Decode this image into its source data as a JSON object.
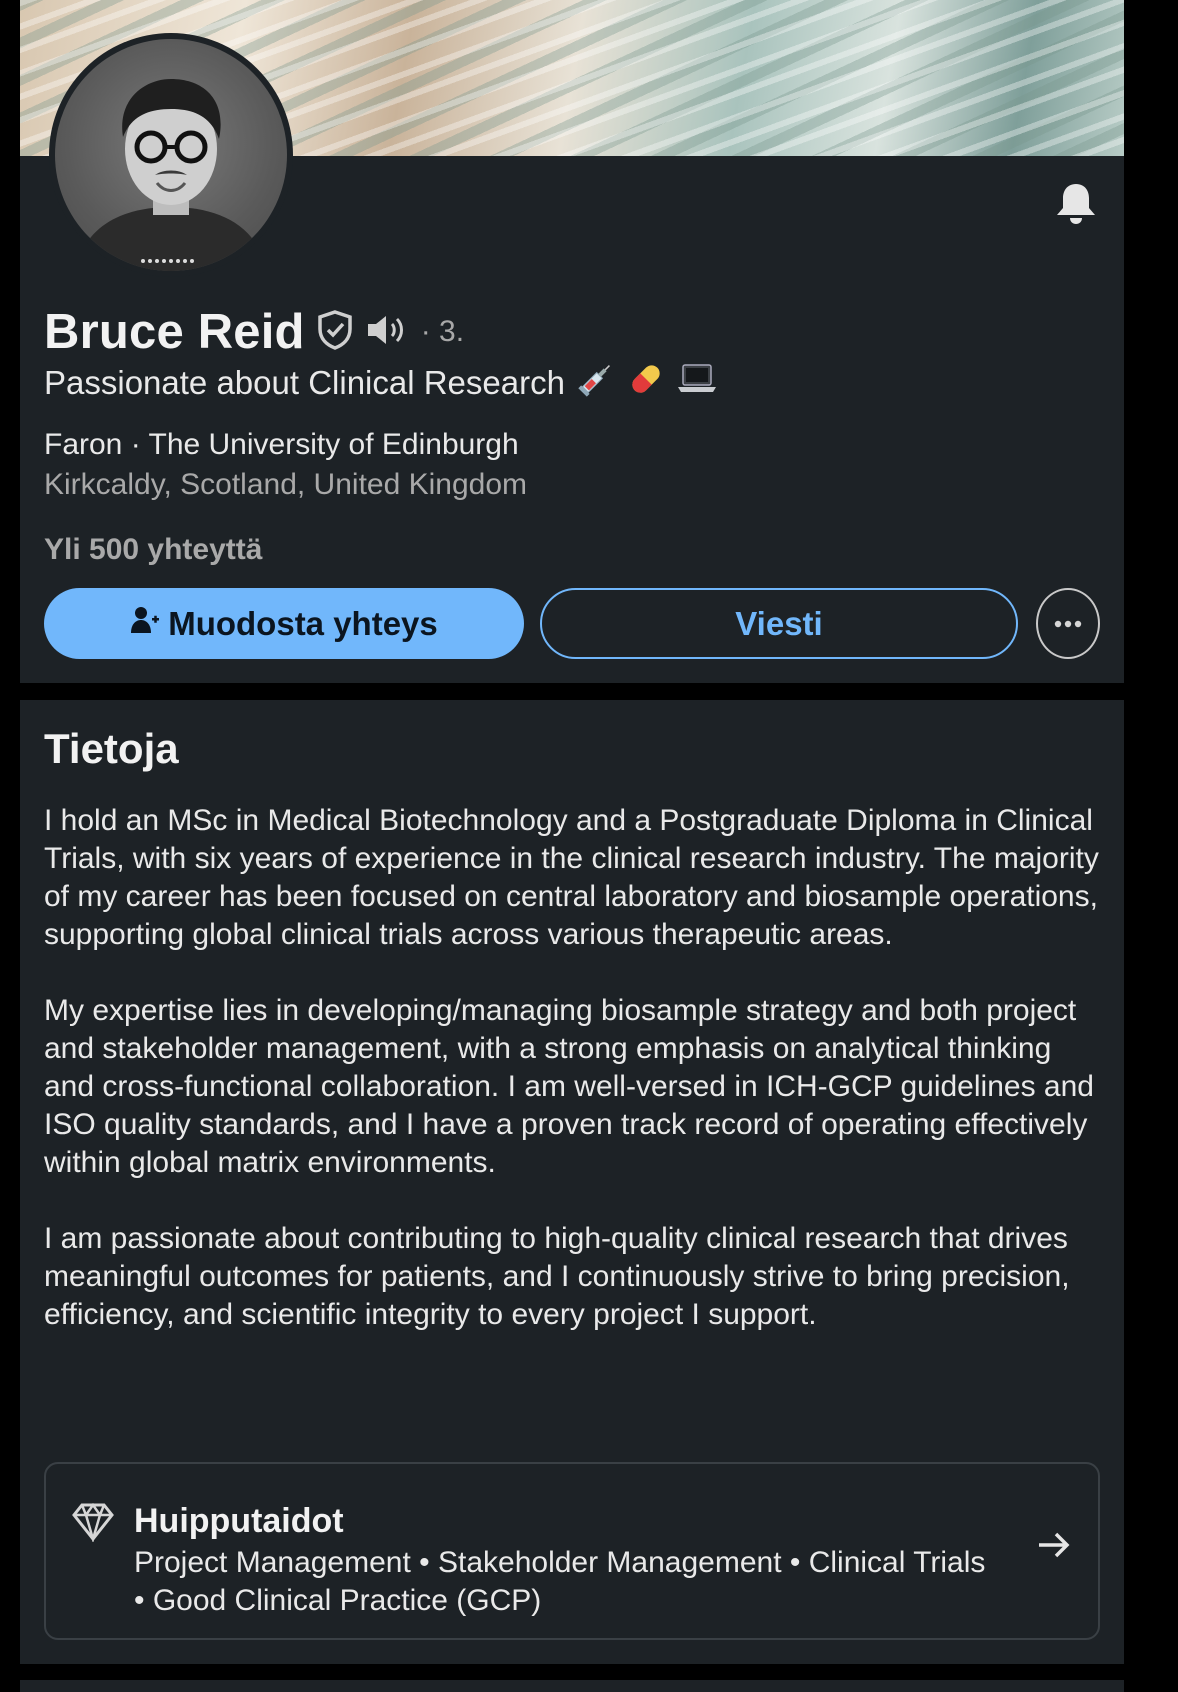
{
  "profile": {
    "name": "Bruce Reid",
    "degree": "· 3.",
    "headline": "Passionate about Clinical Research",
    "headline_emojis": [
      "syringe",
      "pill",
      "laptop"
    ],
    "workplace": "Faron · The University of Edinburgh",
    "location": "Kirkcaldy, Scotland, United Kingdom",
    "connections": "Yli 500 yhteyttä"
  },
  "actions": {
    "connect_label": "Muodosta yhteys",
    "message_label": "Viesti"
  },
  "about": {
    "title": "Tietoja",
    "paragraphs": [
      "I hold an MSc in Medical Biotechnology and a Postgraduate Diploma in Clinical Trials, with six years of experience in the clinical research industry. The majority of my career has been focused on central laboratory and biosample operations, supporting global clinical trials across various therapeutic areas.",
      "My expertise lies in developing/managing biosample strategy and both project and stakeholder management, with a strong emphasis on analytical thinking and cross-functional collaboration. I am well-versed in ICH-GCP guidelines and ISO quality standards, and I have a proven track record of operating effectively within global matrix environments.",
      "I am passionate about contributing to high-quality clinical research that drives meaningful outcomes for patients, and I continuously strive to bring precision, efficiency, and scientific integrity to every project I support."
    ]
  },
  "top_skills": {
    "title": "Huipputaidot",
    "list": "Project Management • Stakeholder Management • Clinical Trials • Good Clinical Practice (GCP)"
  },
  "icons": {
    "verified": "shield-check-icon",
    "audio": "speaker-icon",
    "bell": "bell-icon",
    "connect": "person-add-icon",
    "more": "more-dots-icon",
    "skills": "diamond-icon",
    "arrow": "arrow-right-icon"
  },
  "colors": {
    "background": "#000000",
    "card": "#1d2226",
    "accent": "#71b7fb",
    "text": "#e9e9e9",
    "muted": "#a9a9a9"
  }
}
